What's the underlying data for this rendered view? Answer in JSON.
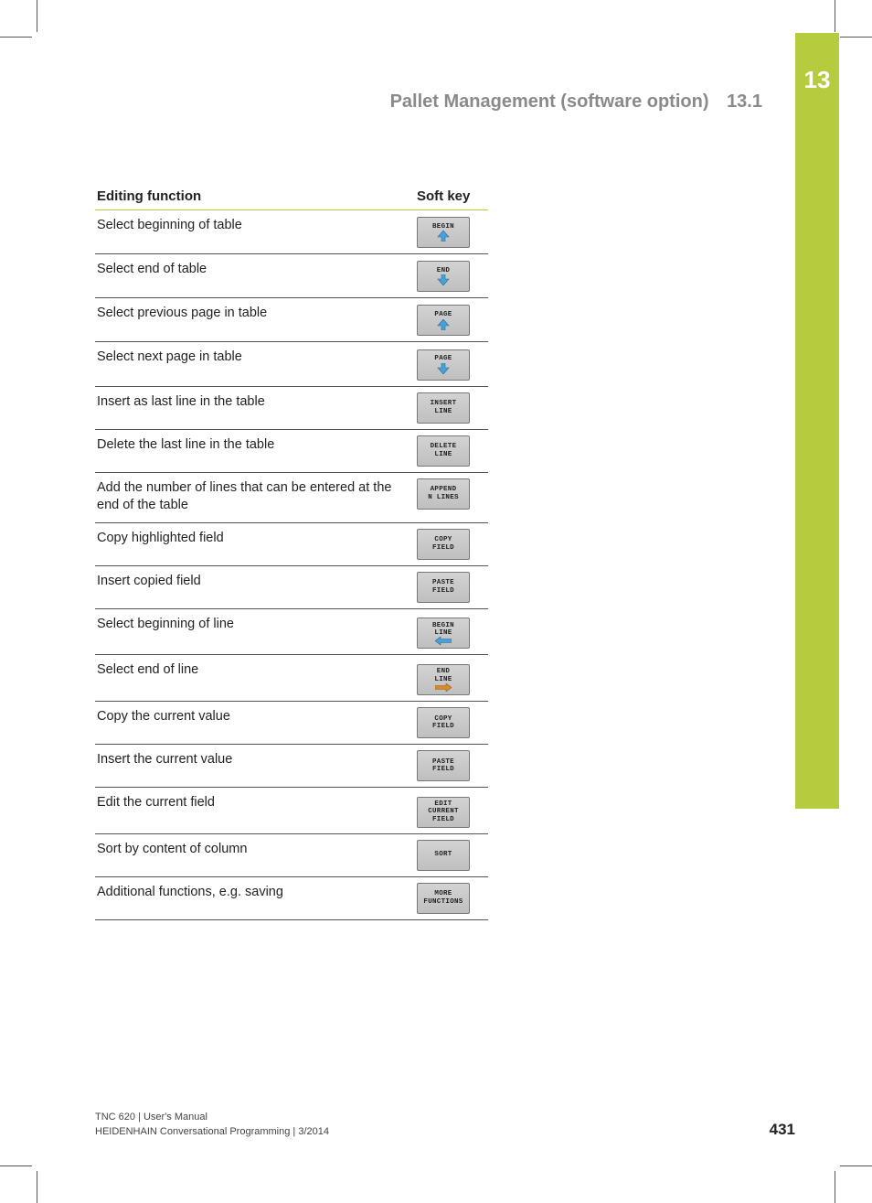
{
  "chapter_number": "13",
  "header": {
    "title": "Pallet Management (software option)",
    "section": "13.1"
  },
  "table": {
    "head_func": "Editing function",
    "head_key": "Soft key",
    "rows": [
      {
        "func": "Select beginning of table",
        "key": {
          "lines": [
            "BEGIN"
          ],
          "arrow": "up"
        }
      },
      {
        "func": "Select end of table",
        "key": {
          "lines": [
            "END"
          ],
          "arrow": "down"
        }
      },
      {
        "func": "Select previous page in table",
        "key": {
          "lines": [
            "PAGE"
          ],
          "arrow": "up"
        }
      },
      {
        "func": "Select next page in table",
        "key": {
          "lines": [
            "PAGE"
          ],
          "arrow": "down"
        }
      },
      {
        "func": "Insert as last line in the table",
        "key": {
          "lines": [
            "INSERT",
            "LINE"
          ]
        }
      },
      {
        "func": "Delete the last line in the table",
        "key": {
          "lines": [
            "DELETE",
            "LINE"
          ]
        }
      },
      {
        "func": "Add the number of lines that can be entered at the end of the table",
        "key": {
          "lines": [
            "APPEND",
            "N LINES"
          ]
        }
      },
      {
        "func": "Copy highlighted field",
        "key": {
          "lines": [
            "COPY",
            "FIELD"
          ]
        }
      },
      {
        "func": "Insert copied field",
        "key": {
          "lines": [
            "PASTE",
            "FIELD"
          ]
        }
      },
      {
        "func": "Select beginning of line",
        "key": {
          "lines": [
            "BEGIN",
            "LINE"
          ],
          "arrow": "left"
        }
      },
      {
        "func": "Select end of line",
        "key": {
          "lines": [
            "END",
            "LINE"
          ],
          "arrow": "right"
        }
      },
      {
        "func": "Copy the current value",
        "key": {
          "lines": [
            "COPY",
            "FIELD"
          ]
        }
      },
      {
        "func": "Insert the current value",
        "key": {
          "lines": [
            "PASTE",
            "FIELD"
          ]
        }
      },
      {
        "func": "Edit the current field",
        "key": {
          "lines": [
            "EDIT",
            "CURRENT",
            "FIELD"
          ]
        }
      },
      {
        "func": "Sort by content of column",
        "key": {
          "lines": [
            "SORT"
          ]
        }
      },
      {
        "func": "Additional functions, e.g. saving",
        "key": {
          "lines": [
            "MORE",
            "FUNCTIONS"
          ]
        }
      }
    ]
  },
  "footer": {
    "line1": "TNC 620 | User's Manual",
    "line2": "HEIDENHAIN Conversational Programming | 3/2014",
    "page": "431"
  },
  "colors": {
    "accent": "#b6cc3e",
    "arrow": "#4aa0d8"
  }
}
